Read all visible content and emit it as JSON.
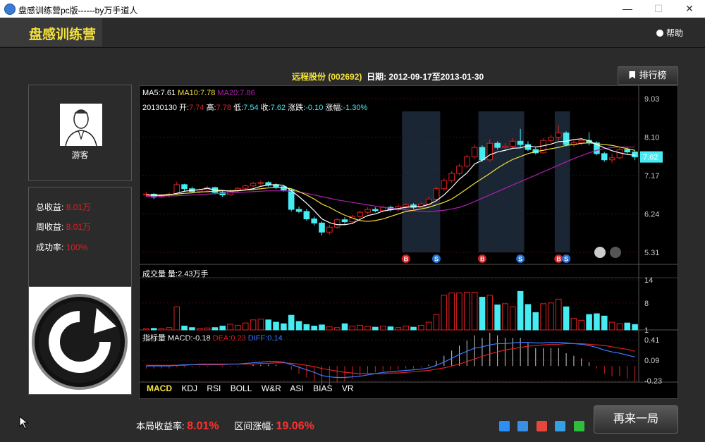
{
  "window": {
    "title": "盘感训练营pc版------by万手道人",
    "minimize": "—",
    "maximize": "☐",
    "close": "✕"
  },
  "header": {
    "logo": "盘感训练营",
    "help": "帮助"
  },
  "stock": {
    "name": "远程股份",
    "code": "(002692)",
    "date_label": "日期:",
    "date_range": "2012-09-17至2013-01-30"
  },
  "rank_button": "排行榜",
  "user": {
    "name": "游客"
  },
  "stats": [
    {
      "label": "总收益:",
      "value": "8.01万"
    },
    {
      "label": "周收益:",
      "value": "8.01万"
    },
    {
      "label": "成功率:",
      "value": "100%"
    }
  ],
  "legend": {
    "ma5": "MA5:7.61",
    "ma10": "MA10:7.78",
    "ma20": "MA20:7.86",
    "date": "20130130",
    "open_l": "开:",
    "open": "7.74",
    "high_l": "高:",
    "high": "7.78",
    "low_l": "低:",
    "low": "7.54",
    "close_l": "收:",
    "close": "7.62",
    "chg_l": "涨跌:",
    "chg": "-0.10",
    "pct_l": "涨幅:",
    "pct": "-1.30%"
  },
  "volume_legend": "成交量 量:2.43万手",
  "macd_legend": {
    "label": "指标量 MACD:-0.18",
    "dea": "DEA:0.23",
    "diff": "DIFF:0.14"
  },
  "price_axis": [
    "9.03",
    "8.10",
    "7.17",
    "6.24",
    "5.31"
  ],
  "current_price": "7.62",
  "volume_axis": [
    "14",
    "8",
    "1"
  ],
  "macd_axis": [
    "0.41",
    "0.09",
    "-0.23"
  ],
  "tabs": [
    "MACD",
    "KDJ",
    "RSI",
    "BOLL",
    "W&R",
    "ASI",
    "BIAS",
    "VR"
  ],
  "trade_markers": [
    "B",
    "S",
    "B",
    "S",
    "B",
    "S"
  ],
  "bottom": {
    "round_label": "本局收益率:",
    "round_value": "8.01%",
    "range_label": "区间涨幅:",
    "range_value": "19.06%"
  },
  "again_button": "再来一局",
  "colors": {
    "up": "#e02020",
    "down": "#46ecf2",
    "ma5": "#ffffff",
    "ma10": "#f4e23a",
    "ma20": "#b01fb0"
  },
  "chart_data": {
    "type": "candlestick",
    "price_ylim": [
      5.31,
      9.03
    ],
    "volume_ylim": [
      1,
      14
    ],
    "macd_ylim": [
      -0.23,
      0.41
    ],
    "candles": [
      [
        6.7,
        6.72,
        6.78,
        6.65
      ],
      [
        6.72,
        6.65,
        6.74,
        6.6
      ],
      [
        6.65,
        6.68,
        6.72,
        6.62
      ],
      [
        6.68,
        6.72,
        6.76,
        6.64
      ],
      [
        6.72,
        6.95,
        7.02,
        6.7
      ],
      [
        6.95,
        6.85,
        6.97,
        6.8
      ],
      [
        6.85,
        6.78,
        6.9,
        6.75
      ],
      [
        6.78,
        6.82,
        6.86,
        6.74
      ],
      [
        6.82,
        6.88,
        6.92,
        6.8
      ],
      [
        6.88,
        6.76,
        6.9,
        6.72
      ],
      [
        6.76,
        6.7,
        6.8,
        6.65
      ],
      [
        6.7,
        6.8,
        6.84,
        6.68
      ],
      [
        6.8,
        6.86,
        6.9,
        6.76
      ],
      [
        6.86,
        6.92,
        6.95,
        6.82
      ],
      [
        6.92,
        6.98,
        7.02,
        6.88
      ],
      [
        6.98,
        7.0,
        7.05,
        6.94
      ],
      [
        7.0,
        6.95,
        7.03,
        6.9
      ],
      [
        6.95,
        6.9,
        6.98,
        6.84
      ],
      [
        6.9,
        6.82,
        6.93,
        6.78
      ],
      [
        6.82,
        6.35,
        6.84,
        6.3
      ],
      [
        6.35,
        6.3,
        6.42,
        6.26
      ],
      [
        6.3,
        6.12,
        6.36,
        6.08
      ],
      [
        6.12,
        6.02,
        6.18,
        5.96
      ],
      [
        6.02,
        5.8,
        6.06,
        5.72
      ],
      [
        5.8,
        5.92,
        5.98,
        5.74
      ],
      [
        5.92,
        6.1,
        6.14,
        5.88
      ],
      [
        6.1,
        6.05,
        6.16,
        6.0
      ],
      [
        6.05,
        6.18,
        6.22,
        6.0
      ],
      [
        6.18,
        6.28,
        6.32,
        6.14
      ],
      [
        6.28,
        6.35,
        6.4,
        6.24
      ],
      [
        6.35,
        6.32,
        6.4,
        6.28
      ],
      [
        6.32,
        6.4,
        6.44,
        6.28
      ],
      [
        6.4,
        6.34,
        6.44,
        6.3
      ],
      [
        6.34,
        6.42,
        6.48,
        6.3
      ],
      [
        6.42,
        6.46,
        6.5,
        6.36
      ],
      [
        6.46,
        6.4,
        6.5,
        6.36
      ],
      [
        6.4,
        6.48,
        6.52,
        6.36
      ],
      [
        6.48,
        6.6,
        6.66,
        6.44
      ],
      [
        6.6,
        6.85,
        6.9,
        6.56
      ],
      [
        6.85,
        7.05,
        7.1,
        6.8
      ],
      [
        7.05,
        7.22,
        7.28,
        7.0
      ],
      [
        7.22,
        7.4,
        7.46,
        7.18
      ],
      [
        7.4,
        7.62,
        7.68,
        7.36
      ],
      [
        7.62,
        7.85,
        7.92,
        7.58
      ],
      [
        7.85,
        7.55,
        7.9,
        7.5
      ],
      [
        7.55,
        7.95,
        8.05,
        7.5
      ],
      [
        7.95,
        7.85,
        8.0,
        7.8
      ],
      [
        7.85,
        7.88,
        7.95,
        7.78
      ],
      [
        7.88,
        8.0,
        8.08,
        7.82
      ],
      [
        8.0,
        7.92,
        8.3,
        7.86
      ],
      [
        7.92,
        7.8,
        8.0,
        7.76
      ],
      [
        7.8,
        7.72,
        7.86,
        7.68
      ],
      [
        7.72,
        8.02,
        8.08,
        7.7
      ],
      [
        8.02,
        8.1,
        8.16,
        7.96
      ],
      [
        8.1,
        8.2,
        8.38,
        8.02
      ],
      [
        8.2,
        7.92,
        8.24,
        7.88
      ],
      [
        7.92,
        7.96,
        8.02,
        7.86
      ],
      [
        7.96,
        8.02,
        8.08,
        7.9
      ],
      [
        8.02,
        7.96,
        8.22,
        7.9
      ],
      [
        7.96,
        7.7,
        8.0,
        7.66
      ],
      [
        7.7,
        7.55,
        7.74,
        7.5
      ],
      [
        7.55,
        7.6,
        7.7,
        7.48
      ],
      [
        7.6,
        7.8,
        7.84,
        7.56
      ],
      [
        7.8,
        7.74,
        7.86,
        7.7
      ],
      [
        7.74,
        7.62,
        7.78,
        7.54
      ]
    ],
    "ma5": [
      6.7,
      6.69,
      6.69,
      6.7,
      6.74,
      6.79,
      6.81,
      6.83,
      6.86,
      6.82,
      6.81,
      6.79,
      6.8,
      6.82,
      6.85,
      6.91,
      6.94,
      6.95,
      6.93,
      6.8,
      6.66,
      6.5,
      6.32,
      6.12,
      6.03,
      5.98,
      5.98,
      6.01,
      6.11,
      6.2,
      6.24,
      6.31,
      6.34,
      6.37,
      6.4,
      6.42,
      6.42,
      6.47,
      6.56,
      6.7,
      6.88,
      7.08,
      7.23,
      7.45,
      7.54,
      7.67,
      7.74,
      7.78,
      7.83,
      7.84,
      7.89,
      7.86,
      7.89,
      7.93,
      7.99,
      8.0,
      8.04,
      8.06,
      8.01,
      7.92,
      7.84,
      7.77,
      7.72,
      7.68,
      7.66
    ],
    "ma10": [
      6.7,
      6.7,
      6.7,
      6.71,
      6.72,
      6.74,
      6.75,
      6.77,
      6.78,
      6.79,
      6.8,
      6.8,
      6.81,
      6.82,
      6.83,
      6.85,
      6.87,
      6.88,
      6.88,
      6.85,
      6.78,
      6.7,
      6.6,
      6.48,
      6.4,
      6.3,
      6.21,
      6.14,
      6.08,
      6.06,
      6.08,
      6.12,
      6.18,
      6.24,
      6.3,
      6.33,
      6.36,
      6.4,
      6.46,
      6.52,
      6.6,
      6.72,
      6.85,
      6.98,
      7.1,
      7.22,
      7.35,
      7.46,
      7.56,
      7.63,
      7.7,
      7.75,
      7.78,
      7.82,
      7.85,
      7.9,
      7.92,
      7.95,
      7.96,
      7.94,
      7.92,
      7.9,
      7.86,
      7.82,
      7.78
    ],
    "ma20": [
      6.66,
      6.67,
      6.67,
      6.68,
      6.68,
      6.69,
      6.7,
      6.71,
      6.72,
      6.73,
      6.74,
      6.75,
      6.76,
      6.77,
      6.78,
      6.79,
      6.8,
      6.8,
      6.8,
      6.79,
      6.77,
      6.74,
      6.7,
      6.66,
      6.62,
      6.58,
      6.55,
      6.52,
      6.49,
      6.46,
      6.43,
      6.4,
      6.38,
      6.36,
      6.34,
      6.32,
      6.3,
      6.3,
      6.31,
      6.33,
      6.36,
      6.4,
      6.46,
      6.54,
      6.62,
      6.7,
      6.78,
      6.86,
      6.94,
      7.02,
      7.1,
      7.18,
      7.26,
      7.34,
      7.42,
      7.5,
      7.58,
      7.65,
      7.72,
      7.78,
      7.82,
      7.85,
      7.86,
      7.86,
      7.86
    ],
    "volume": [
      1.3,
      1.4,
      1.3,
      1.6,
      7.0,
      2.0,
      1.6,
      1.4,
      1.5,
      1.6,
      2.0,
      2.5,
      2.2,
      2.8,
      3.6,
      3.8,
      3.6,
      3.0,
      2.6,
      4.8,
      3.2,
      2.4,
      2.0,
      2.3,
      1.8,
      1.6,
      2.6,
      2.0,
      2.2,
      1.9,
      1.7,
      2.0,
      1.8,
      1.6,
      2.0,
      1.7,
      2.2,
      3.0,
      5.0,
      10.0,
      10.6,
      10.6,
      10.8,
      10.8,
      9.5,
      10.0,
      7.5,
      7.8,
      7.0,
      11.0,
      7.6,
      5.5,
      7.8,
      8.0,
      9.0,
      7.0,
      4.0,
      3.5,
      5.0,
      5.2,
      4.6,
      3.0,
      2.6,
      2.8,
      2.4
    ],
    "macd_hist": [
      -0.02,
      -0.02,
      -0.02,
      -0.02,
      -0.01,
      -0.01,
      -0.01,
      -0.01,
      -0.01,
      0.0,
      -0.01,
      -0.01,
      -0.01,
      0.0,
      0.01,
      0.01,
      0.01,
      0.01,
      0.0,
      -0.03,
      -0.06,
      -0.09,
      -0.12,
      -0.15,
      -0.15,
      -0.13,
      -0.12,
      -0.1,
      -0.08,
      -0.06,
      -0.05,
      -0.04,
      -0.03,
      -0.03,
      -0.02,
      -0.02,
      -0.01,
      0.01,
      0.04,
      0.08,
      0.12,
      0.16,
      0.2,
      0.24,
      0.22,
      0.26,
      0.24,
      0.22,
      0.22,
      0.22,
      0.18,
      0.14,
      0.14,
      0.14,
      0.14,
      0.1,
      0.08,
      0.06,
      0.03,
      -0.02,
      -0.06,
      -0.08,
      -0.08,
      -0.1,
      -0.12
    ],
    "dif": [
      0.0,
      0.0,
      0.0,
      0.0,
      0.01,
      0.02,
      0.02,
      0.03,
      0.03,
      0.03,
      0.03,
      0.03,
      0.03,
      0.04,
      0.05,
      0.06,
      0.07,
      0.07,
      0.06,
      0.02,
      -0.02,
      -0.06,
      -0.1,
      -0.15,
      -0.17,
      -0.18,
      -0.18,
      -0.17,
      -0.16,
      -0.14,
      -0.12,
      -0.1,
      -0.09,
      -0.08,
      -0.07,
      -0.06,
      -0.05,
      -0.03,
      0.01,
      0.06,
      0.12,
      0.18,
      0.23,
      0.28,
      0.3,
      0.33,
      0.35,
      0.35,
      0.36,
      0.37,
      0.37,
      0.36,
      0.36,
      0.37,
      0.37,
      0.36,
      0.35,
      0.34,
      0.32,
      0.29,
      0.25,
      0.22,
      0.2,
      0.17,
      0.14
    ],
    "dea": [
      0.01,
      0.01,
      0.01,
      0.01,
      0.01,
      0.01,
      0.02,
      0.02,
      0.02,
      0.02,
      0.02,
      0.03,
      0.03,
      0.03,
      0.03,
      0.04,
      0.04,
      0.05,
      0.05,
      0.04,
      0.03,
      0.01,
      -0.01,
      -0.04,
      -0.06,
      -0.08,
      -0.1,
      -0.11,
      -0.12,
      -0.12,
      -0.12,
      -0.12,
      -0.11,
      -0.11,
      -0.1,
      -0.09,
      -0.08,
      -0.07,
      -0.05,
      -0.03,
      0.0,
      0.03,
      0.07,
      0.11,
      0.15,
      0.19,
      0.22,
      0.25,
      0.27,
      0.29,
      0.31,
      0.32,
      0.33,
      0.34,
      0.34,
      0.35,
      0.35,
      0.35,
      0.34,
      0.33,
      0.32,
      0.3,
      0.28,
      0.26,
      0.23
    ],
    "markers": [
      {
        "i": 34,
        "t": "B"
      },
      {
        "i": 38,
        "t": "S"
      },
      {
        "i": 44,
        "t": "B"
      },
      {
        "i": 49,
        "t": "S"
      },
      {
        "i": 54,
        "t": "B"
      },
      {
        "i": 55,
        "t": "S"
      }
    ]
  }
}
